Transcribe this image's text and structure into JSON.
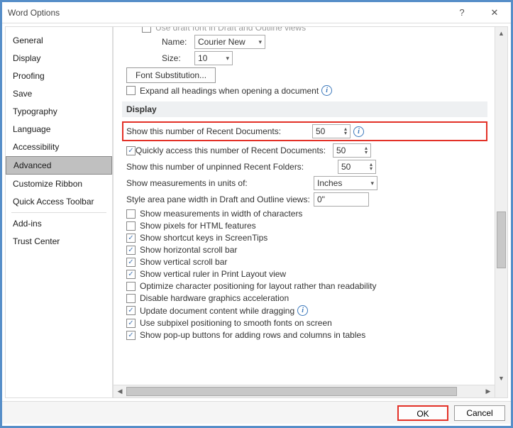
{
  "title": "Word Options",
  "sidebar": {
    "items": [
      {
        "label": "General"
      },
      {
        "label": "Display"
      },
      {
        "label": "Proofing"
      },
      {
        "label": "Save"
      },
      {
        "label": "Typography"
      },
      {
        "label": "Language"
      },
      {
        "label": "Accessibility"
      },
      {
        "label": "Advanced",
        "selected": true
      },
      {
        "label": "Customize Ribbon"
      },
      {
        "label": "Quick Access Toolbar"
      },
      {
        "label": "Add-ins"
      },
      {
        "label": "Trust Center"
      }
    ]
  },
  "content": {
    "cut_line": "Use draft font in Draft and Outline views",
    "font_name_label": "Name:",
    "font_name_value": "Courier New",
    "font_size_label": "Size:",
    "font_size_value": "10",
    "font_sub_btn": "Font Substitution...",
    "expand_headings": {
      "checked": false,
      "label": "Expand all headings when opening a document"
    },
    "section_display": "Display",
    "recent_docs_label": "Show this number of Recent Documents:",
    "recent_docs_value": "50",
    "quick_access": {
      "checked": true,
      "label": "Quickly access this number of Recent Documents:",
      "value": "50"
    },
    "unpinned_folders_label": "Show this number of unpinned Recent Folders:",
    "unpinned_folders_value": "50",
    "measurements_label": "Show measurements in units of:",
    "measurements_value": "Inches",
    "style_area_label": "Style area pane width in Draft and Outline views:",
    "style_area_value": "0\"",
    "checks": [
      {
        "checked": false,
        "label": "Show measurements in width of characters"
      },
      {
        "checked": false,
        "label": "Show pixels for HTML features"
      },
      {
        "checked": true,
        "label": "Show shortcut keys in ScreenTips"
      },
      {
        "checked": true,
        "label": "Show horizontal scroll bar"
      },
      {
        "checked": true,
        "label": "Show vertical scroll bar"
      },
      {
        "checked": true,
        "label": "Show vertical ruler in Print Layout view"
      },
      {
        "checked": false,
        "label": "Optimize character positioning for layout rather than readability"
      },
      {
        "checked": false,
        "label": "Disable hardware graphics acceleration"
      },
      {
        "checked": true,
        "label": "Update document content while dragging"
      },
      {
        "checked": true,
        "label": "Use subpixel positioning to smooth fonts on screen"
      },
      {
        "checked": true,
        "label": "Show pop-up buttons for adding rows and columns in tables"
      }
    ]
  },
  "buttons": {
    "ok": "OK",
    "cancel": "Cancel"
  }
}
